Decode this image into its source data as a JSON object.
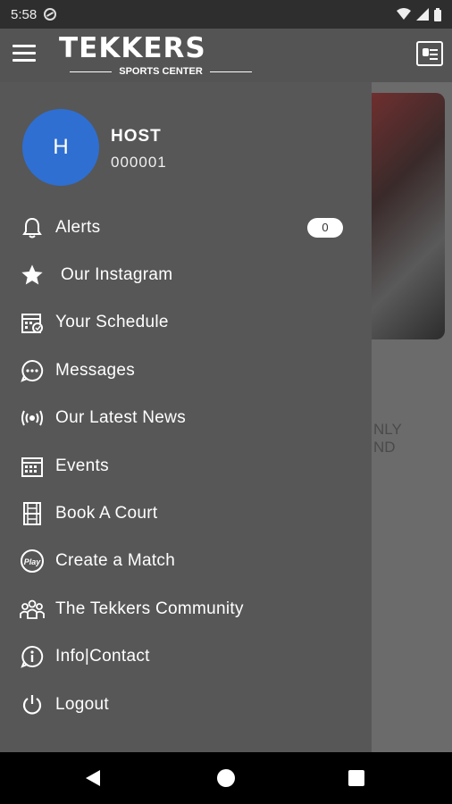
{
  "status_bar": {
    "time": "5:58"
  },
  "app_bar": {
    "logo_word": "TEKKERS",
    "logo_sub": "SPORTS CENTER"
  },
  "background": {
    "partial_text": "NLY\nND"
  },
  "drawer": {
    "user": {
      "initial": "H",
      "name": "HOST",
      "id": "000001"
    },
    "items": [
      {
        "label": "Alerts",
        "icon": "bell-icon",
        "badge": "0"
      },
      {
        "label": "Our Instagram",
        "icon": "star-icon"
      },
      {
        "label": "Your Schedule",
        "icon": "schedule-icon"
      },
      {
        "label": "Messages",
        "icon": "chat-icon"
      },
      {
        "label": "Our Latest News",
        "icon": "broadcast-icon"
      },
      {
        "label": "Events",
        "icon": "calendar-icon"
      },
      {
        "label": "Book A Court",
        "icon": "court-icon"
      },
      {
        "label": "Create a Match",
        "icon": "play-icon"
      },
      {
        "label": "The Tekkers Community",
        "icon": "community-icon"
      },
      {
        "label": "Info|Contact",
        "icon": "info-icon"
      },
      {
        "label": "Logout",
        "icon": "power-icon"
      }
    ]
  },
  "colors": {
    "avatar": "#2f6fd2",
    "drawer": "#575757",
    "appbar": "#545454"
  }
}
